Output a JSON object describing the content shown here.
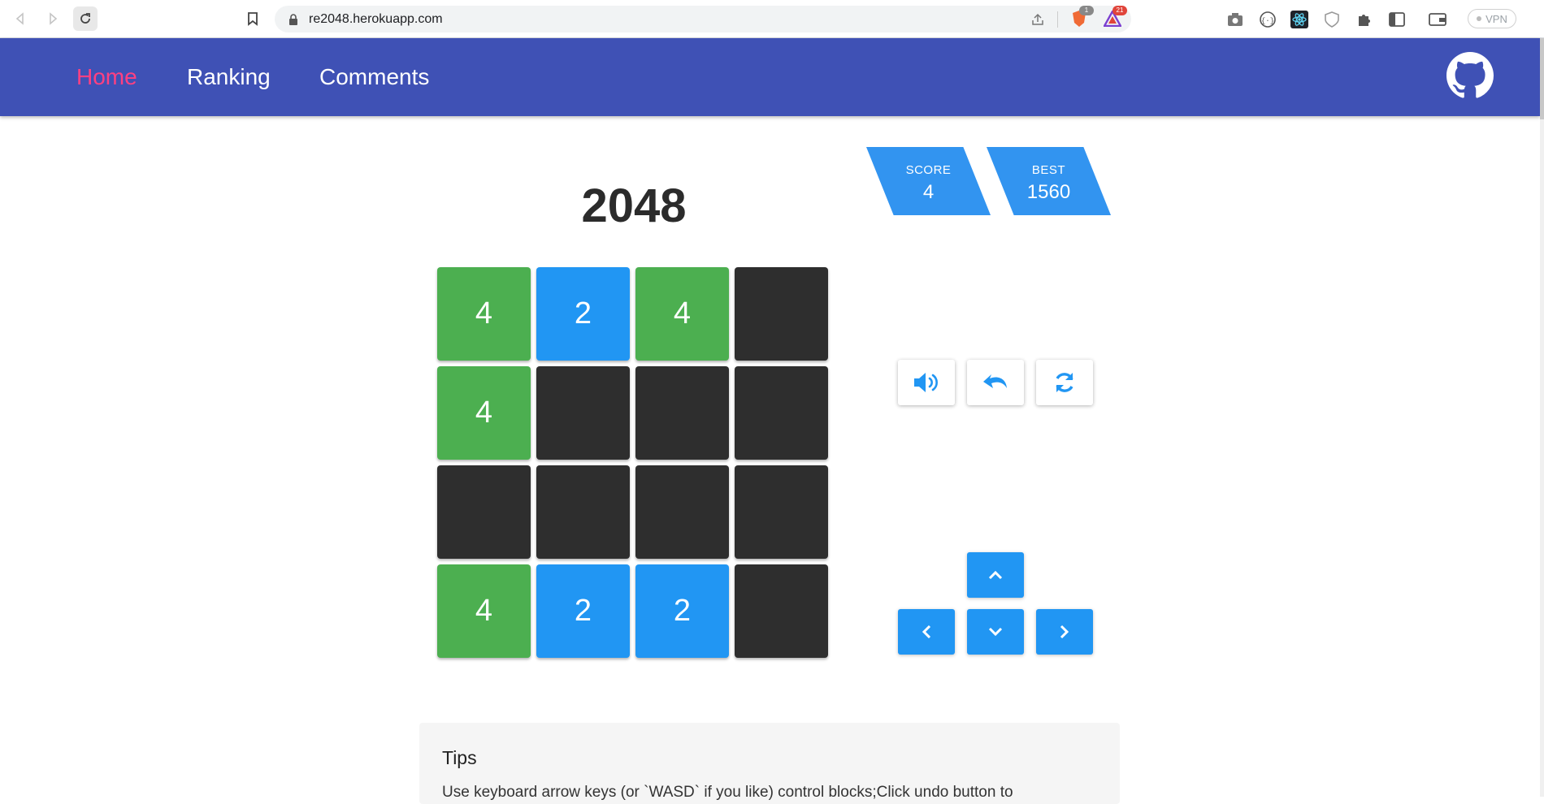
{
  "browser": {
    "url": "re2048.herokuapp.com",
    "extensions": [
      {
        "icon": "brave-shield-icon",
        "badge": "1"
      },
      {
        "icon": "brave-rewards-icon",
        "badge": "21"
      }
    ],
    "vpn_label": "VPN"
  },
  "nav": {
    "items": [
      {
        "label": "Home",
        "active": true
      },
      {
        "label": "Ranking",
        "active": false
      },
      {
        "label": "Comments",
        "active": false
      }
    ],
    "github_icon": "github-icon"
  },
  "game": {
    "title": "2048",
    "score": {
      "label": "SCORE",
      "value": "4"
    },
    "best": {
      "label": "BEST",
      "value": "1560"
    },
    "board": [
      [
        "4",
        "2",
        "4",
        ""
      ],
      [
        "4",
        "",
        "",
        ""
      ],
      [
        "",
        "",
        "",
        ""
      ],
      [
        "4",
        "2",
        "2",
        ""
      ]
    ],
    "controls": [
      "sound-icon",
      "undo-icon",
      "restart-icon"
    ],
    "arrows": [
      "chevron-up-icon",
      "chevron-left-icon",
      "chevron-down-icon",
      "chevron-right-icon"
    ],
    "colors": {
      "tile_2": "#2196f3",
      "tile_4": "#4caf50",
      "empty": "#2e2e2e",
      "accent": "#3294f0",
      "nav": "#3f51b5",
      "nav_active": "#ff4081"
    }
  },
  "tips": {
    "heading": "Tips",
    "text": "Use keyboard arrow keys (or `WASD` if you like) control blocks;Click undo button to"
  }
}
